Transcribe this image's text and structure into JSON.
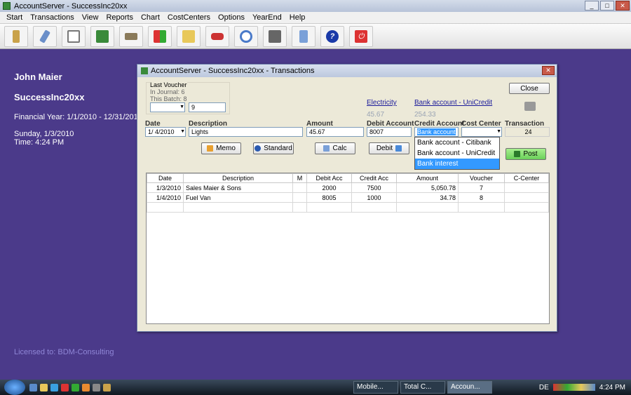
{
  "window": {
    "title": "AccountServer - SuccessInc20xx"
  },
  "menu": [
    "Start",
    "Transactions",
    "View",
    "Reports",
    "Chart",
    "CostCenters",
    "Options",
    "YearEnd",
    "Help"
  ],
  "toolbar_icons": [
    "ledger-icon",
    "pen-icon",
    "grid-icon",
    "book-icon",
    "scales-icon",
    "arrows-icon",
    "folder-icon",
    "car-icon",
    "magnifier-icon",
    "printer-icon",
    "calculator-icon",
    "help-icon",
    "power-icon"
  ],
  "info": {
    "user": "John Maier",
    "company": "SuccessInc20xx",
    "financial_year": "Financial Year:  1/1/2010 - 12/31/2010",
    "day": "Sunday, 1/3/2010",
    "time": "Time:  4:24 PM",
    "licensed": "Licensed to:  BDM-Consulting"
  },
  "dialog": {
    "title": "AccountServer - SuccessInc20xx - Transactions",
    "last_voucher": "Last Voucher",
    "in_journal": "In Journal:  6",
    "this_batch": "This Batch:  8",
    "batch_value": "9",
    "close": "Close",
    "debit_link": "Electricity",
    "debit_amount": "45.67",
    "credit_link": "Bank account - UniCredit",
    "credit_amount": "254.33",
    "labels": {
      "date": "Date",
      "description": "Description",
      "amount": "Amount",
      "debit_account": "Debit Account",
      "credit_account": "Credit Account",
      "cost_center": "Cost Center",
      "transaction": "Transaction"
    },
    "values": {
      "date": "1/ 4/2010",
      "description": "Lights",
      "amount": "45.67",
      "debit_account": "8007",
      "credit_account": "Bank account",
      "transaction": "24"
    },
    "buttons": {
      "memo": "Memo",
      "standard": "Standard",
      "calc": "Calc",
      "debit": "Debit",
      "post": "Post"
    },
    "dropdown": [
      "Bank account - Citibank",
      "Bank account - UniCredit",
      "Bank interest"
    ],
    "columns": [
      "Date",
      "Description",
      "M",
      "Debit Acc",
      "Credit Acc",
      "Amount",
      "Voucher",
      "C-Center"
    ],
    "rows": [
      [
        "1/3/2010",
        "Sales Maier & Sons",
        "",
        "2000",
        "7500",
        "5,050.78",
        "7",
        ""
      ],
      [
        "1/4/2010",
        "Fuel Van",
        "",
        "8005",
        "1000",
        "34.78",
        "8",
        ""
      ]
    ]
  },
  "taskbar": {
    "tasks": [
      "Mobile...",
      "Total C...",
      "Accoun..."
    ],
    "lang": "DE",
    "clock": "4:24 PM"
  },
  "colors": {
    "desktop": "#4b3a8a",
    "post_button": "#7dd66a"
  }
}
